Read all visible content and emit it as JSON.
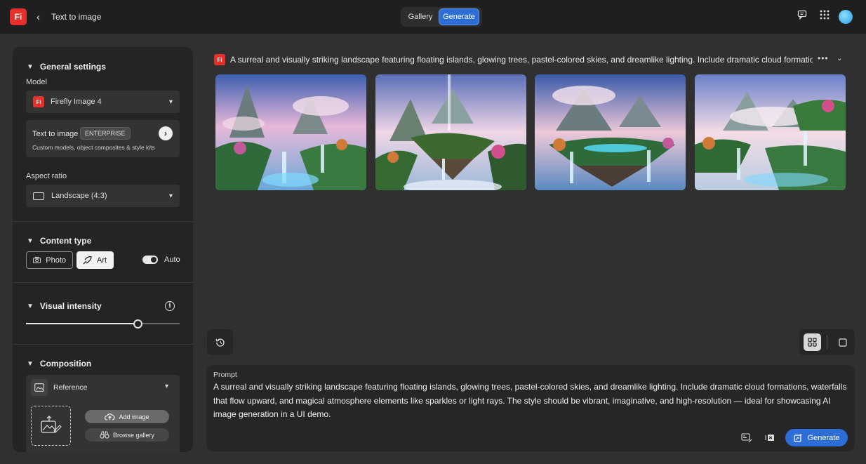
{
  "header": {
    "logo_text": "Fi",
    "back_icon": "chevron-left-icon",
    "title": "Text to image",
    "tabs": [
      "Gallery",
      "Generate"
    ],
    "active_tab": "Generate",
    "right_icons": [
      "feedback-icon",
      "apps-grid-icon",
      "avatar"
    ]
  },
  "panel": {
    "general": {
      "heading": "General settings",
      "model_label": "Model",
      "model_logo": "Fi",
      "model_value": "Firefly Image 4",
      "enterprise_title": "Text to image",
      "enterprise_badge": "ENTERPRISE",
      "enterprise_desc": "Custom models, object composites & style kits",
      "aspect_label": "Aspect ratio",
      "aspect_value": "Landscape (4:3)"
    },
    "content_type": {
      "heading": "Content type",
      "photo_label": "Photo",
      "art_label": "Art",
      "selected": "Art",
      "auto_label": "Auto",
      "auto_on": true
    },
    "visual_intensity": {
      "heading": "Visual intensity",
      "value": 0.73
    },
    "composition": {
      "heading": "Composition",
      "reference_label": "Reference",
      "add_image_label": "Add image",
      "browse_gallery_label": "Browse gallery"
    }
  },
  "main": {
    "prompt_logo": "Fi",
    "prompt_preview": "A surreal and visually striking landscape featuring floating islands, glowing trees, pastel-colored skies, and dreamlike lighting. Include dramatic cloud formations,",
    "image_count": 4,
    "prompt_label": "Prompt",
    "prompt_text": "A surreal and visually striking landscape featuring floating islands, glowing trees, pastel-colored skies, and dreamlike lighting. Include dramatic cloud formations, waterfalls that flow upward, and magical atmosphere elements like sparkles or light rays. The style should be vibrant, imaginative, and high-resolution — ideal for showcasing AI image generation in a UI demo.",
    "generate_label": "Generate"
  },
  "colors": {
    "accent": "#2c6ed5",
    "brand": "#e4312b",
    "background": "#303030",
    "panel": "#242424"
  }
}
